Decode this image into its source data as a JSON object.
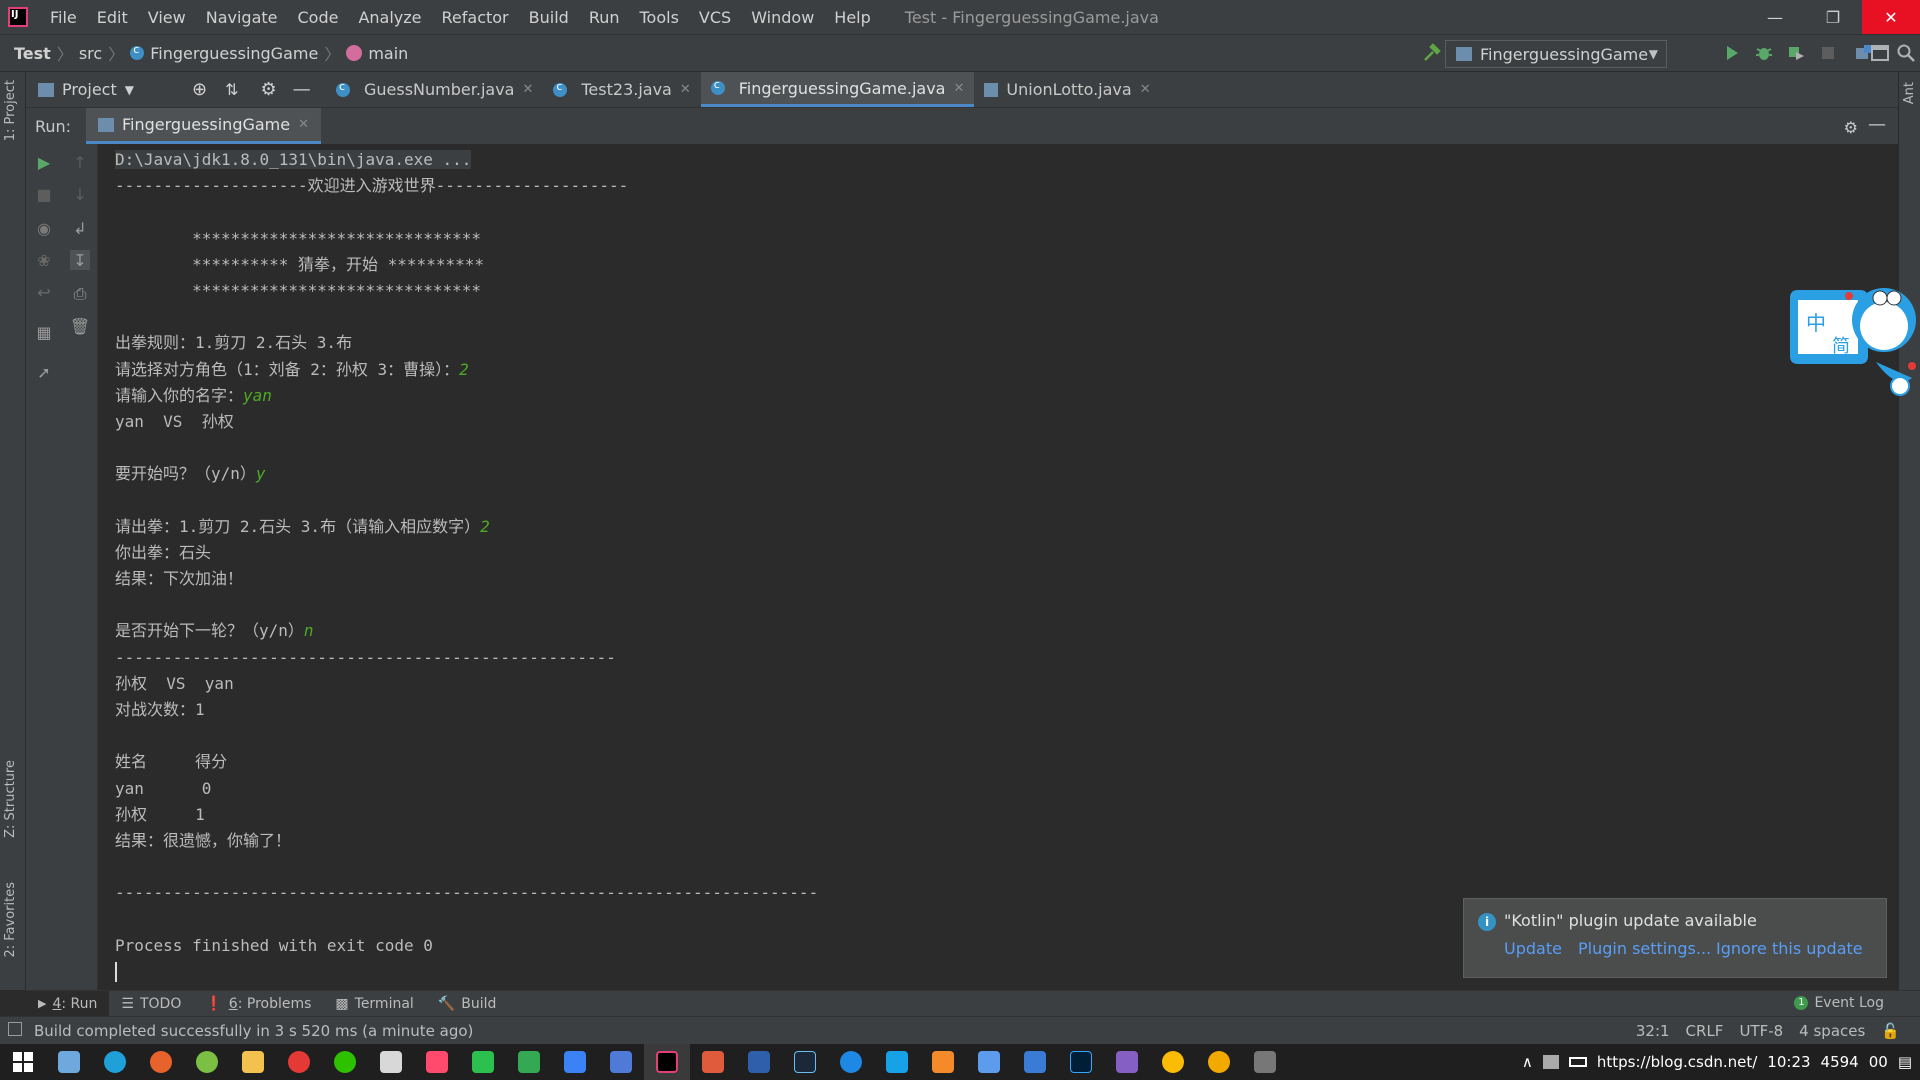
{
  "menu": {
    "items": [
      "File",
      "Edit",
      "View",
      "Navigate",
      "Code",
      "Analyze",
      "Refactor",
      "Build",
      "Run",
      "Tools",
      "VCS",
      "Window",
      "Help"
    ],
    "window_title": "Test - FingerguessingGame.java"
  },
  "nav": {
    "crumbs": [
      "Test",
      "src",
      "FingerguessingGame",
      "main"
    ],
    "run_config": "FingerguessingGame"
  },
  "project_panel": {
    "label": "Project"
  },
  "editor_tabs": [
    "GuessNumber.java",
    "Test23.java",
    "FingerguessingGame.java",
    "UnionLotto.java"
  ],
  "run_window": {
    "label": "Run:",
    "tab": "FingerguessingGame"
  },
  "left_stripe": {
    "project": "1: Project",
    "structure": "Z: Structure",
    "favorites": "2: Favorites"
  },
  "right_stripe": {
    "ant": "Ant"
  },
  "console": {
    "lines": [
      {
        "text": "D:\\Java\\jdk1.8.0_131\\bin\\java.exe ...",
        "input": ""
      },
      {
        "text": "--------------------欢迎进入游戏世界--------------------",
        "input": ""
      },
      {
        "text": "",
        "input": ""
      },
      {
        "text": "        ******************************",
        "input": ""
      },
      {
        "text": "        ********** 猜拳，开始 **********",
        "input": ""
      },
      {
        "text": "        ******************************",
        "input": ""
      },
      {
        "text": "",
        "input": ""
      },
      {
        "text": "出拳规则：1.剪刀 2.石头 3.布",
        "input": ""
      },
      {
        "text": "请选择对方角色（1：刘备 2：孙权 3：曹操）：",
        "input": "2"
      },
      {
        "text": "请输入你的名字：",
        "input": "yan"
      },
      {
        "text": "yan  VS  孙权",
        "input": ""
      },
      {
        "text": "",
        "input": ""
      },
      {
        "text": "要开始吗？（y/n）",
        "input": "y"
      },
      {
        "text": "",
        "input": ""
      },
      {
        "text": "请出拳：1.剪刀 2.石头 3.布（请输入相应数字）",
        "input": "2"
      },
      {
        "text": "你出拳：石头",
        "input": ""
      },
      {
        "text": "结果：下次加油！",
        "input": ""
      },
      {
        "text": "",
        "input": ""
      },
      {
        "text": "是否开始下一轮？（y/n）",
        "input": "n"
      },
      {
        "text": "----------------------------------------------------",
        "input": ""
      },
      {
        "text": "孙权  VS  yan",
        "input": ""
      },
      {
        "text": "对战次数：1",
        "input": ""
      },
      {
        "text": "",
        "input": ""
      },
      {
        "text": "姓名     得分",
        "input": ""
      },
      {
        "text": "yan      0",
        "input": ""
      },
      {
        "text": "孙权     1",
        "input": ""
      },
      {
        "text": "结果：很遗憾，你输了！",
        "input": ""
      },
      {
        "text": "",
        "input": ""
      },
      {
        "text": "-------------------------------------------------------------------------",
        "input": ""
      },
      {
        "text": "",
        "input": ""
      },
      {
        "text": "Process finished with exit code 0",
        "input": ""
      }
    ]
  },
  "ime": {
    "char1": "中",
    "char2": "简"
  },
  "notification": {
    "title": "\"Kotlin\" plugin update available",
    "links": [
      "Update",
      "Plugin settings...",
      "Ignore this update"
    ]
  },
  "toolwindows": {
    "run_num": "4",
    "run": ": Run",
    "todo": "TODO",
    "problems_num": "6",
    "problems": ": Problems",
    "terminal": "Terminal",
    "build": "Build",
    "event_log": "Event Log",
    "event_count": "1"
  },
  "status": {
    "message": "Build completed successfully in 3 s 520 ms (a minute ago)",
    "position": "32:1",
    "line_sep": "CRLF",
    "encoding": "UTF-8",
    "indent": "4 spaces"
  },
  "tray": {
    "url_fragment": "https://blog.csdn.net/",
    "time": "10:23",
    "number_fragment": "4594",
    "end_fragment": "00"
  },
  "colors": {
    "accent": "#4a88c7",
    "input_green": "#4eaa25",
    "link": "#589df6",
    "close_red": "#e81123"
  }
}
